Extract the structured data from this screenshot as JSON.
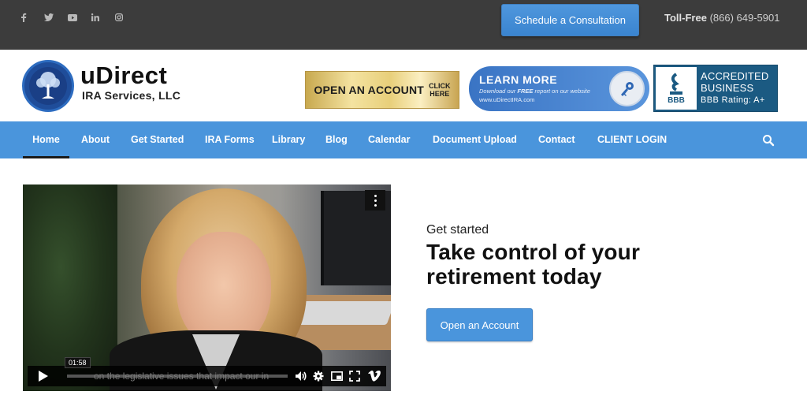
{
  "topbar": {
    "social_icons": [
      "facebook-icon",
      "twitter-icon",
      "youtube-icon",
      "linkedin-icon",
      "instagram-icon"
    ],
    "consult_label": "Schedule a Consultation",
    "tollfree_label": "Toll-Free",
    "tollfree_number": "(866) 649-5901"
  },
  "header": {
    "logo_title": "uDirect",
    "logo_sub": "IRA Services, LLC",
    "ad_open": {
      "main": "OPEN AN ACCOUNT",
      "click_line1": "CLICK",
      "click_line2": "HERE"
    },
    "ad_learn": {
      "title": "LEARN MORE",
      "sub_pre": "Download our ",
      "sub_free": "FREE",
      "sub_post": " report on our website",
      "url": "www.uDirectIRA.com"
    },
    "ad_bbb": {
      "logo_text": "BBB",
      "line1": "ACCREDITED",
      "line2": "BUSINESS",
      "rating": "BBB Rating: A+"
    }
  },
  "nav": {
    "items": [
      "Home",
      "About",
      "Get Started",
      "IRA Forms",
      "Library",
      "Blog",
      "Calendar",
      "Document Upload",
      "Contact",
      "CLIENT LOGIN"
    ],
    "active": "Home"
  },
  "video": {
    "time": "01:58",
    "caption": "on the legislative issues that impact our in"
  },
  "hero": {
    "eyebrow": "Get started",
    "title": "Take control of your retirement today",
    "button_label": "Open an Account"
  },
  "colors": {
    "accent": "#4a95dc",
    "topbar": "#3c3c3c",
    "bbb": "#1b5a82"
  }
}
